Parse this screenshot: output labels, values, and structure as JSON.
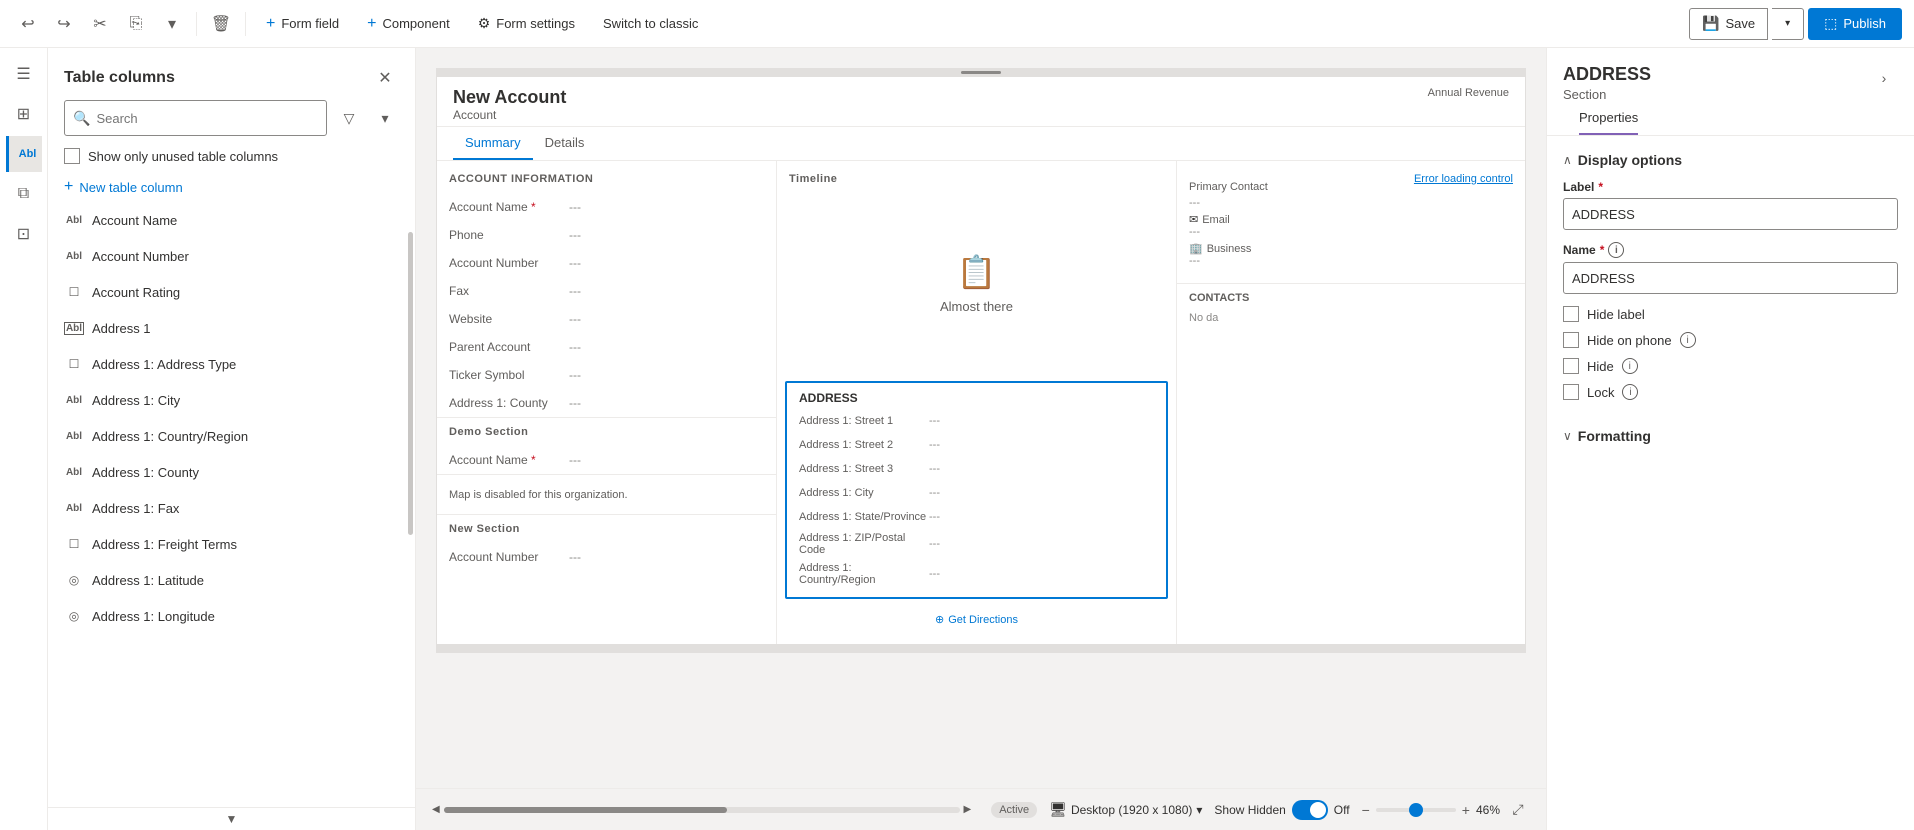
{
  "toolbar": {
    "undo_label": "↩",
    "redo_label": "↪",
    "cut_label": "✂",
    "copy_label": "⎘",
    "dropdown_label": "▾",
    "delete_label": "🗑",
    "form_field_label": "Form field",
    "component_label": "Component",
    "form_settings_label": "Form settings",
    "switch_classic_label": "Switch to classic",
    "save_label": "Save",
    "publish_label": "Publish"
  },
  "left_nav": {
    "icons": [
      {
        "name": "menu-icon",
        "symbol": "☰"
      },
      {
        "name": "grid-icon",
        "symbol": "⊞"
      },
      {
        "name": "text-field-icon",
        "symbol": "Abl"
      },
      {
        "name": "layers-icon",
        "symbol": "⧠"
      },
      {
        "name": "component-icon",
        "symbol": "⊡"
      }
    ]
  },
  "sidebar": {
    "title": "Table columns",
    "search_placeholder": "Search",
    "unused_label": "Show only unused table columns",
    "new_column_label": "New table column",
    "columns": [
      {
        "name": "Account Name",
        "icon": "text-icon",
        "symbol": "Abl"
      },
      {
        "name": "Account Number",
        "icon": "text-icon",
        "symbol": "Abl"
      },
      {
        "name": "Account Rating",
        "icon": "checkbox-icon",
        "symbol": "☐"
      },
      {
        "name": "Address 1",
        "icon": "text-icon",
        "symbol": "Abl"
      },
      {
        "name": "Address 1: Address Type",
        "icon": "checkbox-icon",
        "symbol": "☐"
      },
      {
        "name": "Address 1: City",
        "icon": "text-icon",
        "symbol": "Abl"
      },
      {
        "name": "Address 1: Country/Region",
        "icon": "text-icon",
        "symbol": "Abl"
      },
      {
        "name": "Address 1: County",
        "icon": "text-icon",
        "symbol": "Abl"
      },
      {
        "name": "Address 1: Fax",
        "icon": "text-icon",
        "symbol": "Abl"
      },
      {
        "name": "Address 1: Freight Terms",
        "icon": "checkbox-icon",
        "symbol": "☐"
      },
      {
        "name": "Address 1: Latitude",
        "icon": "location-icon",
        "symbol": "◎"
      },
      {
        "name": "Address 1: Longitude",
        "icon": "location-icon",
        "symbol": "◎"
      }
    ]
  },
  "canvas": {
    "form_title": "New Account",
    "form_subtitle": "Account",
    "annual_revenue_label": "Annual Revenue",
    "tabs": [
      {
        "label": "Summary",
        "active": true
      },
      {
        "label": "Details",
        "active": false
      }
    ],
    "account_info_section": "ACCOUNT INFORMATION",
    "fields": [
      {
        "label": "Account Name",
        "required": true,
        "value": "---"
      },
      {
        "label": "Phone",
        "required": false,
        "value": "---"
      },
      {
        "label": "Account Number",
        "required": false,
        "value": "---"
      },
      {
        "label": "Fax",
        "required": false,
        "value": "---"
      },
      {
        "label": "Website",
        "required": false,
        "value": "---"
      },
      {
        "label": "Parent Account",
        "required": false,
        "value": "---"
      },
      {
        "label": "Ticker Symbol",
        "required": false,
        "value": "---"
      },
      {
        "label": "Address 1: County",
        "required": false,
        "value": "---"
      }
    ],
    "timeline_section": "Timeline",
    "timeline_icon": "📋",
    "timeline_text": "Almost there",
    "error_control": "Error loading control",
    "address_section_title": "ADDRESS",
    "address_fields": [
      {
        "label": "Address 1: Street 1",
        "value": "---"
      },
      {
        "label": "Address 1: Street 2",
        "value": "---"
      },
      {
        "label": "Address 1: Street 3",
        "value": "---"
      },
      {
        "label": "Address 1: City",
        "value": "---"
      },
      {
        "label": "Address 1: State/Province",
        "value": "---"
      },
      {
        "label": "Address 1: ZIP/Postal Code",
        "value": "---"
      },
      {
        "label": "Address 1: Country/Region",
        "value": "---"
      }
    ],
    "demo_section": "Demo Section",
    "demo_field_label": "Account Name",
    "demo_field_required": true,
    "demo_field_value": "---",
    "map_text": "Map is disabled for this organization.",
    "get_directions_label": "Get Directions",
    "primary_contact_label": "Primary Contact",
    "email_label": "Email",
    "business_label": "Business",
    "contacts_label": "CONTACTS",
    "no_data_label": "No da",
    "new_section_title": "New Section",
    "new_section_field": "Account Number",
    "new_section_value": "---",
    "active_badge": "Active",
    "desktop_label": "Desktop (1920 x 1080)",
    "show_hidden_label": "Show Hidden",
    "hidden_toggle": "Off",
    "zoom_percent": "46%"
  },
  "right_panel": {
    "main_title": "ADDRESS",
    "subtitle": "Section",
    "tabs": [
      {
        "label": "Properties",
        "active": true
      }
    ],
    "display_options_title": "Display options",
    "label_field": {
      "label": "Label",
      "required": true,
      "value": "ADDRESS"
    },
    "name_field": {
      "label": "Name",
      "required": true,
      "value": "ADDRESS"
    },
    "checkboxes": [
      {
        "label": "Hide label",
        "checked": false
      },
      {
        "label": "Hide on phone",
        "checked": false,
        "info": true
      },
      {
        "label": "Hide",
        "checked": false,
        "info": true
      },
      {
        "label": "Lock",
        "checked": false,
        "info": true
      }
    ],
    "formatting_title": "Formatting"
  }
}
